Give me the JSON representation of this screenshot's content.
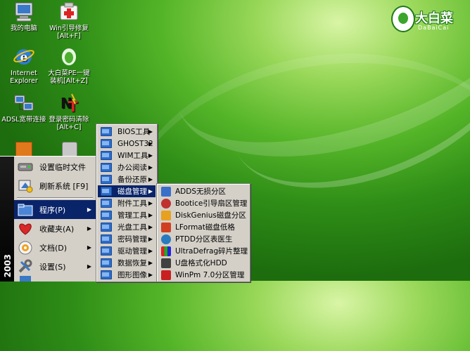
{
  "desktop_icons": [
    {
      "label": "我的电脑",
      "icon": "my-computer-icon"
    },
    {
      "label": "Win引导修复",
      "label2": "[Alt+F]",
      "icon": "boot-repair-icon"
    },
    {
      "label": "Internet",
      "label2": "Explorer",
      "icon": "internet-explorer-icon"
    },
    {
      "label": "大白菜PE一键",
      "label2": "装机[Alt+Z]",
      "icon": "dabaicai-install-icon"
    },
    {
      "label": "ADSL宽带连接",
      "icon": "adsl-connection-icon"
    },
    {
      "label": "登录密码清除",
      "label2": "[Alt+C]",
      "icon": "password-clear-icon"
    }
  ],
  "logo": {
    "name": "大白菜",
    "sub": "DaBaiCai"
  },
  "start_menu": {
    "banner": "2003",
    "items": [
      {
        "label": "设置临时文件",
        "icon": "temp-files-icon"
      },
      {
        "label": "刷新系统 [F9]",
        "icon": "refresh-system-icon"
      },
      {
        "label": "程序(P)",
        "icon": "programs-icon"
      },
      {
        "label": "收藏夹(A)",
        "icon": "favorites-icon"
      },
      {
        "label": "文档(D)",
        "icon": "documents-icon"
      },
      {
        "label": "设置(S)",
        "icon": "settings-icon"
      }
    ]
  },
  "programs_menu": {
    "items": [
      "BIOS工具",
      "GHOST32",
      "WIM工具",
      "办公阅读",
      "备份还原",
      "磁盘管理",
      "附件工具",
      "管理工具",
      "光盘工具",
      "密码管理",
      "驱动管理",
      "数据恢复",
      "图形图像"
    ]
  },
  "disk_menu": {
    "items": [
      {
        "label": "ADDS无损分区",
        "icon": "adds-partition-icon",
        "color": "#3a6fc9"
      },
      {
        "label": "Bootice引导扇区管理",
        "icon": "bootice-icon",
        "color": "#c03030"
      },
      {
        "label": "DiskGenius磁盘分区",
        "icon": "diskgenius-icon",
        "color": "#e8a020"
      },
      {
        "label": "LFormat磁盘低格",
        "icon": "lformat-icon",
        "color": "#d04020"
      },
      {
        "label": "PTDD分区表医生",
        "icon": "ptdd-icon",
        "color": "#2a7ac0"
      },
      {
        "label": "UltraDefrag碎片整理",
        "icon": "ultradefrag-icon",
        "color": "#6a3ab0"
      },
      {
        "label": "U盘格式化HDD",
        "icon": "usb-format-icon",
        "color": "#404040"
      },
      {
        "label": "WinPm 7.0分区管理",
        "icon": "winpm-icon",
        "color": "#c82020"
      }
    ]
  }
}
